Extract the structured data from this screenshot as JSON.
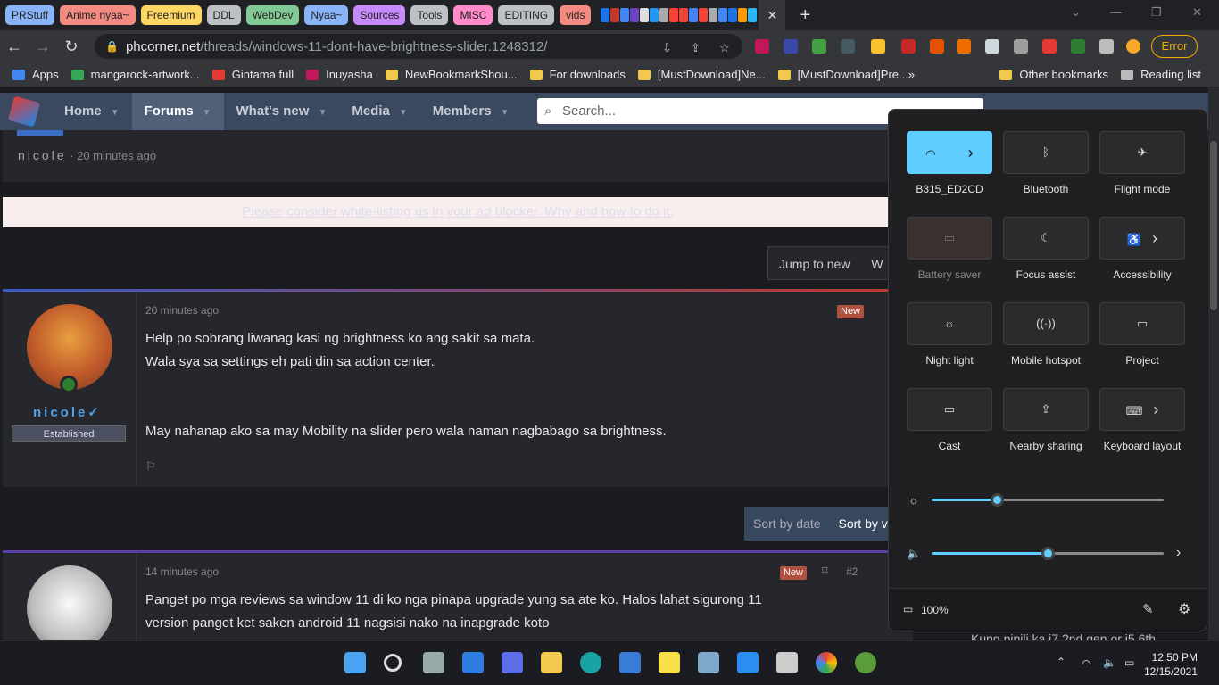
{
  "tabs": {
    "groups": [
      {
        "label": "PRStuff",
        "color": "#8ab4f8"
      },
      {
        "label": "Anime nyaa~",
        "color": "#f28b82"
      },
      {
        "label": "Freemium",
        "color": "#fdd663"
      },
      {
        "label": "DDL",
        "color": "#bdc1c6"
      },
      {
        "label": "WebDev",
        "color": "#81c995"
      },
      {
        "label": "Nyaa~",
        "color": "#8ab4f8"
      },
      {
        "label": "Sources",
        "color": "#c58af9"
      },
      {
        "label": "Tools",
        "color": "#bdc1c6"
      },
      {
        "label": "MISC",
        "color": "#ff8bcb"
      },
      {
        "label": "EDITING",
        "color": "#bdc1c6"
      },
      {
        "label": "vids",
        "color": "#f28b82"
      }
    ],
    "active_close": "✕",
    "new_tab": "+"
  },
  "address": {
    "host": "phcorner.net",
    "path": "/threads/windows-11-dont-have-brightness-slider.1248312/",
    "error_label": "Error"
  },
  "bookmarks": [
    "Apps",
    "mangarock-artwork...",
    "Gintama full",
    "Inuyasha",
    "NewBookmarkShou...",
    "For downloads",
    "[MustDownload]Ne...",
    "[MustDownload]Pre...",
    "Other bookmarks",
    "Reading list"
  ],
  "site": {
    "nav": [
      {
        "label": "Home"
      },
      {
        "label": "Forums",
        "active": true
      },
      {
        "label": "What's new"
      },
      {
        "label": "Media"
      },
      {
        "label": "Members"
      }
    ],
    "search_placeholder": "Search...",
    "thread_author": "nicole",
    "thread_time": "· 20 minutes ago",
    "ad_notice": "Please consider white-listing us in your ad blocker. Why and how to do it.",
    "jump_label": "Jump to new",
    "jump_label2": "W",
    "post1": {
      "time": "20 minutes ago",
      "badge": "New",
      "username": "nicole",
      "rank": "Established",
      "lines": [
        "Help po sobrang liwanag kasi ng brightness ko ang sakit sa mata.",
        "Wala sya sa settings eh pati din sa action center.",
        "",
        "",
        "May nahanap ako sa may Mobility na slider pero wala naman nagbabago sa brightness."
      ]
    },
    "sort": {
      "by_date": "Sort by date",
      "by_votes": "Sort by v"
    },
    "post2": {
      "time": "14 minutes ago",
      "badge": "New",
      "number": "#2",
      "lines": [
        "Panget po mga reviews sa window 11 di ko nga pinapa upgrade yung sa ate ko. Halos lahat sigurong 11",
        "version panget ket saken android 11 nagsisi nako na inapgrade koto"
      ]
    },
    "sidebar_snippet": "Kung pipili ka i7 2nd gen or i5 6th"
  },
  "quick_settings": {
    "tiles": [
      {
        "label": "B315_ED2CD",
        "icon": "wifi-icon",
        "on": true
      },
      {
        "label": "Bluetooth",
        "icon": "bluetooth-icon",
        "on": false
      },
      {
        "label": "Flight mode",
        "icon": "airplane-icon",
        "on": false
      },
      {
        "label": "Battery saver",
        "icon": "battery-saver-icon",
        "on": false,
        "disabled": true
      },
      {
        "label": "Focus assist",
        "icon": "moon-icon",
        "on": false
      },
      {
        "label": "Accessibility",
        "icon": "accessibility-icon",
        "on": false
      },
      {
        "label": "Night light",
        "icon": "sun-icon",
        "on": false
      },
      {
        "label": "Mobile hotspot",
        "icon": "hotspot-icon",
        "on": false
      },
      {
        "label": "Project",
        "icon": "project-icon",
        "on": false
      },
      {
        "label": "Cast",
        "icon": "cast-icon",
        "on": false
      },
      {
        "label": "Nearby sharing",
        "icon": "share-icon",
        "on": false
      },
      {
        "label": "Keyboard layout",
        "icon": "keyboard-icon",
        "on": false
      }
    ],
    "brightness": 0.28,
    "volume": 0.5,
    "battery_label": "100%"
  },
  "taskbar": {
    "time": "12:50 PM",
    "date": "12/15/2021"
  }
}
